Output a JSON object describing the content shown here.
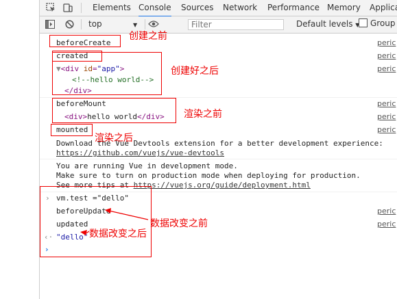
{
  "devtools": {
    "tabs": [
      "Elements",
      "Console",
      "Sources",
      "Network",
      "Performance",
      "Memory",
      "Applica"
    ],
    "active_tab": "Console",
    "accent_color": "#1a73e8"
  },
  "toolbar": {
    "context": "top",
    "filter_placeholder": "Filter",
    "levels": "Default levels",
    "group_label": "Group"
  },
  "console": {
    "before_create": "beforeCreate",
    "created": "created",
    "div_open_tag": "div",
    "div_attr": "id",
    "div_attr_value": "\"app\"",
    "comment": "<!--hello world-->",
    "div_close": "</div>",
    "before_mount": "beforeMount",
    "hello_world": "hello world",
    "mounted": "mounted",
    "devtools_msg": "Download the Vue Devtools extension for a better development experience:",
    "devtools_url": "https://github.com/vuejs/vue-devtools",
    "dev_mode_1": "You are running Vue in development mode.",
    "dev_mode_2": "Make sure to turn on production mode when deploying for production.",
    "dev_mode_3_prefix": "See more tips at ",
    "dev_mode_url": "https://vuejs.org/guide/deployment.html",
    "input_cmd": "vm.test =\"dello\"",
    "before_update": "beforeUpdate",
    "updated": "updated",
    "result": "\"dello\"",
    "source_link": "peric"
  },
  "annotations": {
    "before_create": "创建之前",
    "after_create": "创建好之后",
    "before_render": "渲染之前",
    "after_render": "渲染之后",
    "before_data_change": "数据改变之前",
    "after_data_change": "数据改变之后",
    "color": "#e00000"
  }
}
